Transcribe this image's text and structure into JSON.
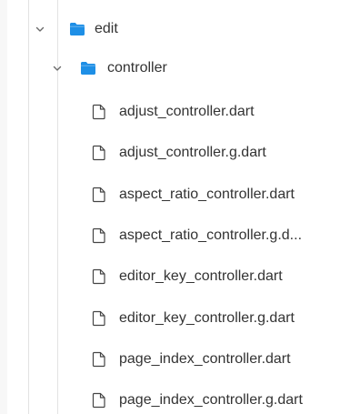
{
  "tree": {
    "folders": [
      {
        "label": "edit",
        "expanded": true,
        "icon": "folder-icon",
        "chevron": "chevron-down-icon"
      },
      {
        "label": "controller",
        "expanded": true,
        "icon": "folder-icon",
        "chevron": "chevron-down-icon"
      }
    ],
    "files": [
      {
        "label": "adjust_controller.dart",
        "icon": "file-icon"
      },
      {
        "label": "adjust_controller.g.dart",
        "icon": "file-icon"
      },
      {
        "label": "aspect_ratio_controller.dart",
        "icon": "file-icon"
      },
      {
        "label": "aspect_ratio_controller.g.d...",
        "icon": "file-icon"
      },
      {
        "label": "editor_key_controller.dart",
        "icon": "file-icon"
      },
      {
        "label": "editor_key_controller.g.dart",
        "icon": "file-icon"
      },
      {
        "label": "page_index_controller.dart",
        "icon": "file-icon"
      },
      {
        "label": "page_index_controller.g.dart",
        "icon": "file-icon"
      }
    ]
  },
  "colors": {
    "folder": "#1e8fe6",
    "text": "#333333",
    "chevron": "#6b6b6b",
    "guide": "#e2e2e2"
  }
}
